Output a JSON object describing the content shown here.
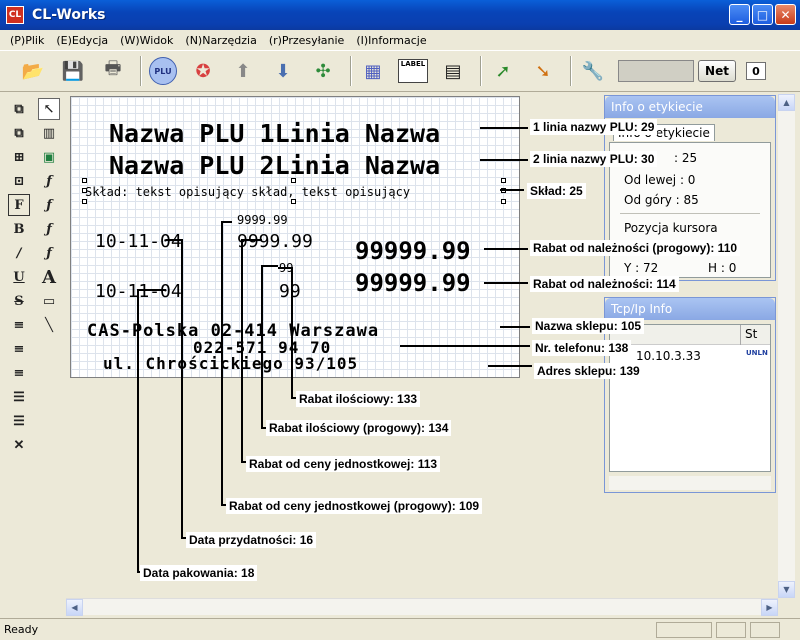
{
  "window": {
    "title": "CL-Works",
    "icon_text": "CL"
  },
  "menu": [
    "(P)Plik",
    "(E)Edycja",
    "(W)Widok",
    "(N)Narzędzia",
    "(r)Przesyłanie",
    "(I)Informacje"
  ],
  "toolbar": {
    "net_label": "Net",
    "counter": "0",
    "label_icon_text": "LABEL",
    "plu_icon_text": "PLU"
  },
  "canvas": {
    "line1": "Nazwa PLU 1Linia  Nazwa",
    "line2": "Nazwa PLU 2Linia  Nazwa",
    "sklad": "Skład: tekst opisujący skład, tekst opisujący",
    "date1": "10-11-04",
    "date2": "10-11-04",
    "price_small1": "9999.99",
    "price_big1": "9999.99",
    "price_small2": "99",
    "price_big2": "99",
    "rabat1": "99999.99",
    "rabat2": "99999.99",
    "shop_name": "CAS-Polska 02-414 Warszawa",
    "phone": "022-571 94 70",
    "address": "ul. Chrościckiego 93/105"
  },
  "callouts": {
    "c1": "1 linia nazwy PLU: 29",
    "c2": "2 linia nazwy PLU: 30",
    "c3": "Skład: 25",
    "c4": "Rabat od należności (progowy): 110",
    "c5": "Rabat od należności: 114",
    "c6": "Nazwa sklepu: 105",
    "c7": "Nr. telefonu: 138",
    "c8": "Adres sklepu: 139",
    "c9": "Rabat ilościowy: 133",
    "c10": "Rabat ilościowy (progowy): 134",
    "c11": "Rabat od ceny jednostkowej: 113",
    "c12": "Rabat od ceny jednostkowej (progowy): 109",
    "c13": "Data przydatności: 16",
    "c14": "Data pakowania: 18"
  },
  "info_panel": {
    "title": "Info o etykiecie",
    "tab": "Info o etykiecie",
    "row1": ": 25",
    "od_lewej": "Od lewej : 0",
    "od_gory": "Od góry : 85",
    "pozycja": "Pozycja kursora",
    "y": "Y : 72",
    "h": "H : 0"
  },
  "tcp_panel": {
    "title": "Tcp/Ip Info",
    "col_st": "St",
    "ip": "10.10.3.33",
    "status_icon": "UNLN"
  },
  "status": {
    "text": "Ready"
  }
}
